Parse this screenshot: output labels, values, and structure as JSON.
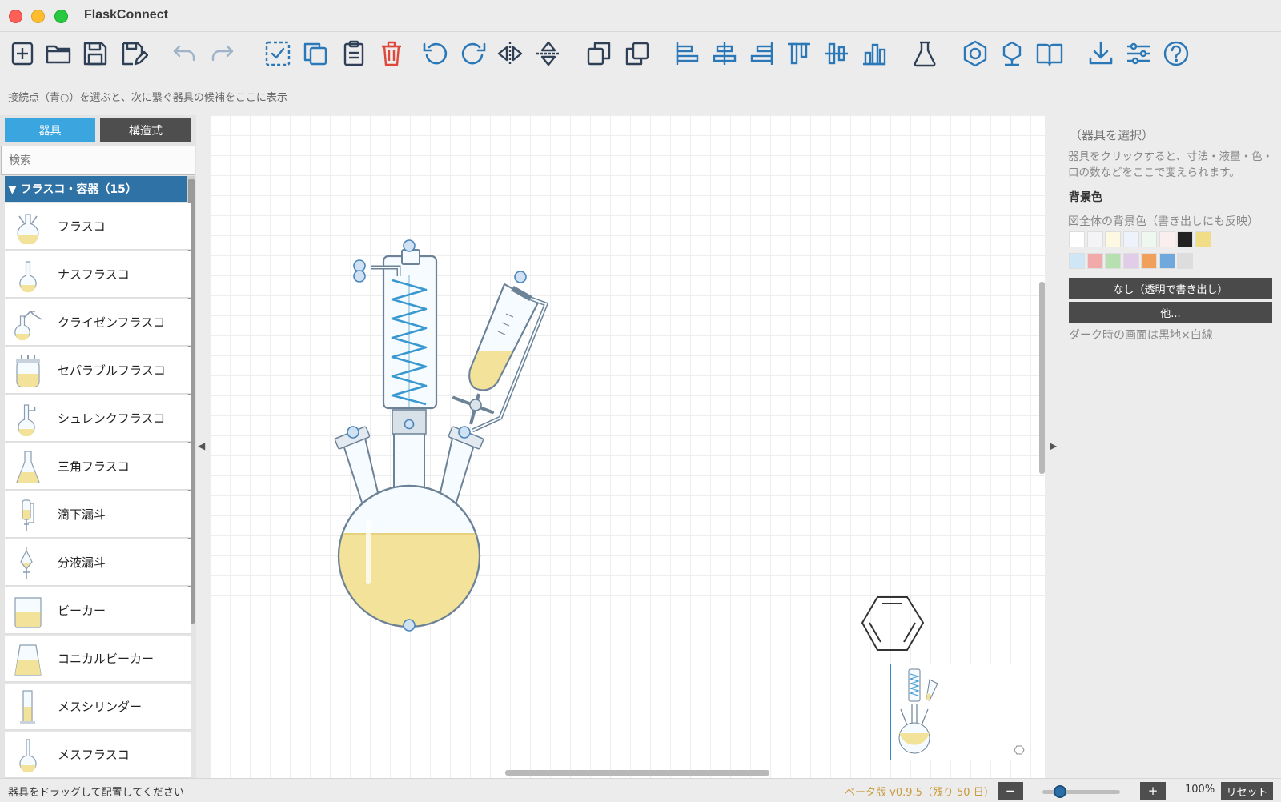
{
  "app": {
    "title": "FlaskConnect"
  },
  "toolbar": {
    "icons": [
      "new-file-icon",
      "open-folder-icon",
      "save-icon",
      "save-as-icon",
      "undo-icon",
      "redo-icon",
      "select-all-icon",
      "duplicate-icon",
      "paste-icon",
      "delete-icon",
      "rotate-left-icon",
      "rotate-right-icon",
      "flip-horizontal-icon",
      "flip-vertical-icon",
      "bring-back-icon",
      "bring-front-icon",
      "align-left-icon",
      "align-center-icon",
      "align-right-icon",
      "align-top-icon",
      "align-middle-icon",
      "align-bottom-icon",
      "flask-icon",
      "hexagon-icon",
      "benzene-node-icon",
      "book-icon",
      "download-icon",
      "settings-sliders-icon",
      "help-icon"
    ],
    "colors": {
      "dark": "#2f3f55",
      "blue": "#2b78b8",
      "gray": "#9fb4c8",
      "red": "#e0473a"
    }
  },
  "hint": {
    "text": "接続点（青○）を選ぶと、次に繋ぐ器具の候補をここに表示"
  },
  "left_panel": {
    "tabs": [
      {
        "label": "器具",
        "active": true
      },
      {
        "label": "構造式",
        "active": false
      }
    ],
    "search_placeholder": "検索",
    "category": {
      "label": "▼ フラスコ・容器（15）"
    },
    "items": [
      {
        "label": "フラスコ",
        "icon": "three-neck-flask-icon"
      },
      {
        "label": "ナスフラスコ",
        "icon": "round-flask-icon"
      },
      {
        "label": "クライゼンフラスコ",
        "icon": "claisen-flask-icon"
      },
      {
        "label": "セパラブルフラスコ",
        "icon": "separable-flask-icon"
      },
      {
        "label": "シュレンクフラスコ",
        "icon": "schlenk-flask-icon"
      },
      {
        "label": "三角フラスコ",
        "icon": "erlenmeyer-flask-icon"
      },
      {
        "label": "滴下漏斗",
        "icon": "dropping-funnel-icon"
      },
      {
        "label": "分液漏斗",
        "icon": "separatory-funnel-icon"
      },
      {
        "label": "ビーカー",
        "icon": "beaker-icon"
      },
      {
        "label": "コニカルビーカー",
        "icon": "conical-beaker-icon"
      },
      {
        "label": "メスシリンダー",
        "icon": "graduated-cylinder-icon"
      },
      {
        "label": "メスフラスコ",
        "icon": "volumetric-flask-icon"
      }
    ]
  },
  "right_panel": {
    "title": "（器具を選択）",
    "description": "器具をクリックすると、寸法・液量・色・口の数などをここで変えられます。",
    "bg_heading": "背景色",
    "bg_desc": "図全体の背景色（書き出しにも反映）",
    "swatches_row1": [
      "#ffffff",
      "#f4f4f6",
      "#fdf8e2",
      "#eef3fb",
      "#eef8ee",
      "#fbeeee",
      "#222222",
      "#f2dd87"
    ],
    "swatches_row2": [
      "#cfe6f6",
      "#f2a9a9",
      "#b6e0b0",
      "#e1cde8",
      "#f0a05a",
      "#6fa8dc",
      "#dddddd"
    ],
    "btn_none": "なし（透明で書き出し）",
    "btn_other": "他...",
    "note": "ダーク時の画面は黒地×白線"
  },
  "status": {
    "left": "器具をドラッグして配置してください",
    "beta": "ベータ版 v0.9.5（残り 50 日）",
    "zoom_minus": "−",
    "zoom_plus": "+",
    "zoom_level": "100%",
    "reset": "リセット",
    "zoom_slider_value": 100
  },
  "theme": {
    "accent": "#3aa5de",
    "category": "#2f72a6",
    "liquid": "#f2e29a",
    "glass": "#6c8297",
    "coil": "#3a98d0",
    "minimap_border": "#3a86c8"
  }
}
